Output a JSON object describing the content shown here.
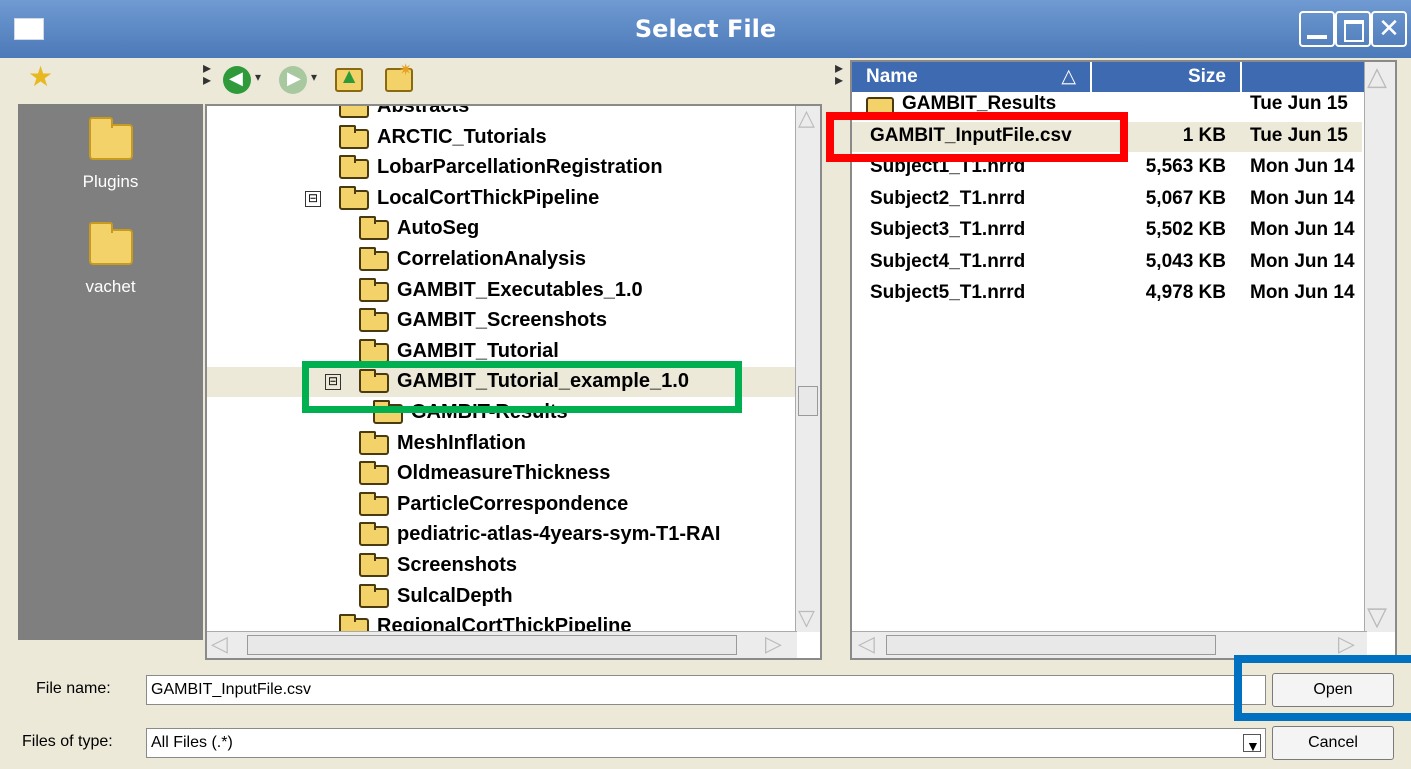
{
  "window": {
    "title": "Select File",
    "controls": [
      "minimize-icon",
      "maximize-icon",
      "close-icon"
    ]
  },
  "places": {
    "items": [
      {
        "label": "Plugins",
        "icon": "folder-icon"
      },
      {
        "label": "vachet",
        "icon": "folder-icon"
      }
    ]
  },
  "toolbar": {
    "icons": [
      "bookmark-star-icon",
      "back-icon",
      "forward-icon",
      "up-folder-icon",
      "new-folder-icon"
    ]
  },
  "tree": {
    "rows": [
      {
        "label": "Abstracts",
        "level": 1,
        "expander": "",
        "selected": false
      },
      {
        "label": "ARCTIC_Tutorials",
        "level": 1,
        "expander": "",
        "selected": false
      },
      {
        "label": "LobarParcellationRegistration",
        "level": 1,
        "expander": "",
        "selected": false
      },
      {
        "label": "LocalCortThickPipeline",
        "level": 1,
        "expander": "⊟",
        "selected": false
      },
      {
        "label": "AutoSeg",
        "level": 2,
        "expander": "",
        "selected": false
      },
      {
        "label": "CorrelationAnalysis",
        "level": 2,
        "expander": "",
        "selected": false
      },
      {
        "label": "GAMBIT_Executables_1.0",
        "level": 2,
        "expander": "",
        "selected": false
      },
      {
        "label": "GAMBIT_Screenshots",
        "level": 2,
        "expander": "",
        "selected": false
      },
      {
        "label": "GAMBIT_Tutorial",
        "level": 2,
        "expander": "",
        "selected": false
      },
      {
        "label": "GAMBIT_Tutorial_example_1.0",
        "level": 2,
        "expander": "⊟",
        "selected": true
      },
      {
        "label": "GAMBIT-Results",
        "level": 3,
        "expander": "",
        "selected": false
      },
      {
        "label": "MeshInflation",
        "level": 2,
        "expander": "",
        "selected": false
      },
      {
        "label": "OldmeasureThickness",
        "level": 2,
        "expander": "",
        "selected": false
      },
      {
        "label": "ParticleCorrespondence",
        "level": 2,
        "expander": "",
        "selected": false
      },
      {
        "label": "pediatric-atlas-4years-sym-T1-RAI",
        "level": 2,
        "expander": "",
        "selected": false
      },
      {
        "label": "Screenshots",
        "level": 2,
        "expander": "",
        "selected": false
      },
      {
        "label": "SulcalDepth",
        "level": 2,
        "expander": "",
        "selected": false
      },
      {
        "label": "RegionalCortThickPipeline",
        "level": 1,
        "expander": "",
        "selected": false
      }
    ]
  },
  "files": {
    "columns": {
      "name": "Name",
      "size": "Size",
      "modified": ""
    },
    "sort_indicator": "△",
    "rows": [
      {
        "name": "GAMBIT_Results",
        "size": "",
        "modified": "Tue Jun 15",
        "is_folder": true,
        "selected": false
      },
      {
        "name": "GAMBIT_InputFile.csv",
        "size": "1 KB",
        "modified": "Tue Jun 15",
        "is_folder": false,
        "selected": true
      },
      {
        "name": "Subject1_T1.nrrd",
        "size": "5,563 KB",
        "modified": "Mon Jun 14",
        "is_folder": false,
        "selected": false
      },
      {
        "name": "Subject2_T1.nrrd",
        "size": "5,067 KB",
        "modified": "Mon Jun 14",
        "is_folder": false,
        "selected": false
      },
      {
        "name": "Subject3_T1.nrrd",
        "size": "5,502 KB",
        "modified": "Mon Jun 14",
        "is_folder": false,
        "selected": false
      },
      {
        "name": "Subject4_T1.nrrd",
        "size": "5,043 KB",
        "modified": "Mon Jun 14",
        "is_folder": false,
        "selected": false
      },
      {
        "name": "Subject5_T1.nrrd",
        "size": "4,978 KB",
        "modified": "Mon Jun 14",
        "is_folder": false,
        "selected": false
      }
    ]
  },
  "footer": {
    "file_name_label": "File name:",
    "file_name_value": "GAMBIT_InputFile.csv",
    "file_type_label": "Files of type:",
    "file_type_value": "All Files (.*)",
    "open_label": "Open",
    "cancel_label": "Cancel"
  },
  "highlights": {
    "file_box_color": "#ff0000",
    "folder_box_color": "#00b050",
    "open_box_color": "#0070c0"
  },
  "colors": {
    "titlebar": "#4c79b8",
    "header": "#3e6ab2",
    "selection": "#ece9d8",
    "places_bg": "#7f7f7f"
  }
}
